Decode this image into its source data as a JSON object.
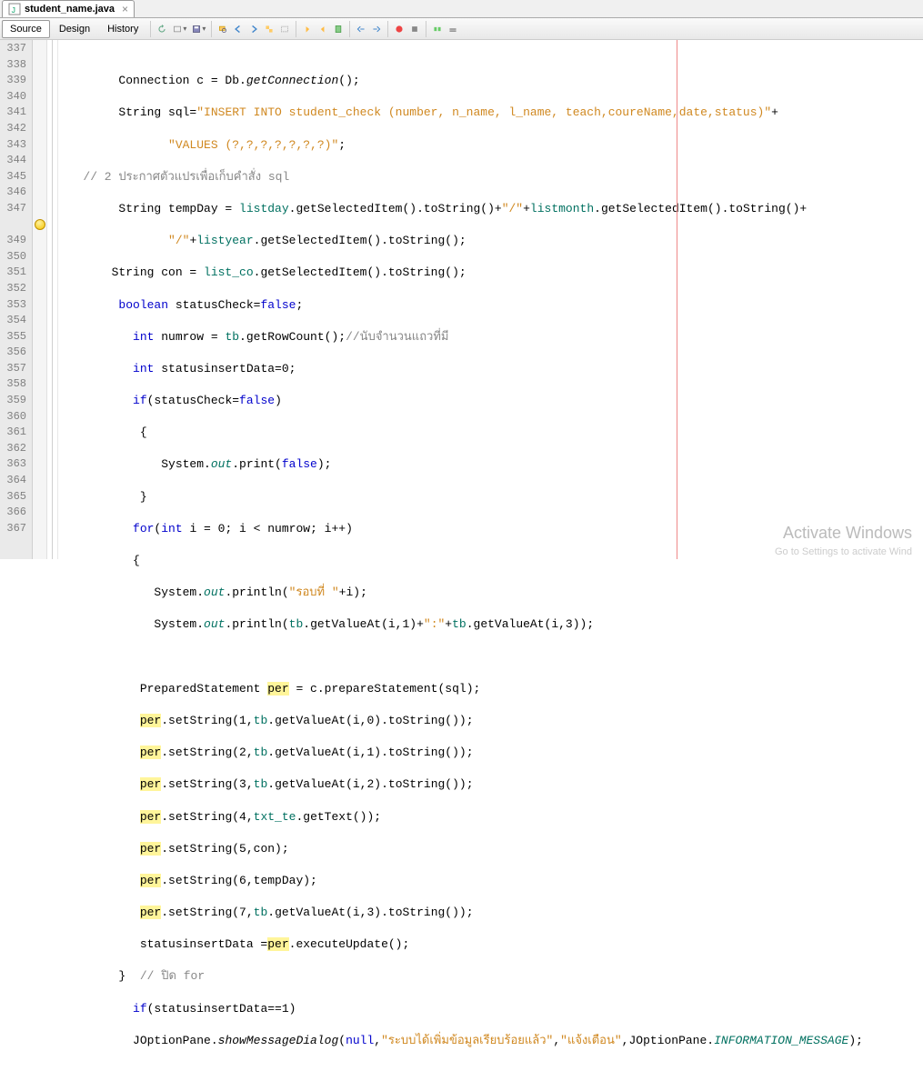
{
  "tab": {
    "title": "student_name.java"
  },
  "views": {
    "source": "Source",
    "design": "Design",
    "history": "History"
  },
  "lines": [
    "337",
    "338",
    "339",
    "340",
    "341",
    "342",
    "343",
    "344",
    "345",
    "346",
    "347",
    "",
    "349",
    "350",
    "351",
    "352",
    "353",
    "354",
    "355",
    "356",
    "357",
    "358",
    "359",
    "360",
    "361",
    "362",
    "363",
    "364",
    "365",
    "366",
    "367"
  ],
  "bulb_at": 11,
  "code": {
    "l337": [
      "        Connection c = Db.",
      "getConnection",
      "();"
    ],
    "l338": [
      "        String sql=",
      "\"INSERT INTO student_check (number, n_name, l_name, teach,coureName,date,status)\"",
      "+"
    ],
    "l339": [
      "               ",
      "\"VALUES (?,?,?,?,?,?,?)\"",
      ";"
    ],
    "l340": [
      "   // 2 ประกาศตัวแปรเพื่อเก็บคำสั่ง sql"
    ],
    "l341a": "        String tempDay = ",
    "l341b": "listday",
    "l341c": ".getSelectedItem().toString()+",
    "l341d": "\"/\"",
    "l341e": "+",
    "l341f": "listmonth",
    "l341g": ".getSelectedItem().toString()+",
    "l342a": "               ",
    "l342b": "\"/\"",
    "l342c": "+",
    "l342d": "listyear",
    "l342e": ".getSelectedItem().toString();",
    "l343a": "       String con = ",
    "l343b": "list_co",
    "l343c": ".getSelectedItem().toString();",
    "l344a": "        ",
    "l344b": "boolean",
    "l344c": " statusCheck=",
    "l344d": "false",
    "l344e": ";",
    "l345a": "          ",
    "l345b": "int",
    "l345c": " numrow = ",
    "l345d": "tb",
    "l345e": ".getRowCount();",
    "l345f": "//นับจำนวนแถวที่มี",
    "l346a": "          ",
    "l346b": "int",
    "l346c": " statusinsertData=0;",
    "l347a": "          ",
    "l347b": "if",
    "l347c": "(statusCheck=",
    "l347d": "false",
    "l347e": ")",
    "l348": "           {",
    "l349a": "              System.",
    "l349b": "out",
    "l349c": ".print(",
    "l349d": "false",
    "l349e": ");",
    "l350": "           }",
    "l351a": "          ",
    "l351b": "for",
    "l351c": "(",
    "l351d": "int",
    "l351e": " i = 0; i < numrow; i++)",
    "l352": "          {",
    "l353a": "             System.",
    "l353b": "out",
    "l353c": ".println(",
    "l353d": "\"รอบที่ \"",
    "l353e": "+i);",
    "l354a": "             System.",
    "l354b": "out",
    "l354c": ".println(",
    "l354d": "tb",
    "l354e": ".getValueAt(i,1)+",
    "l354f": "\":\"",
    "l354g": "+",
    "l354h": "tb",
    "l354i": ".getValueAt(i,3));",
    "l355": "",
    "l356a": "           PreparedStatement ",
    "l356b": "per",
    "l356c": " = c.prepareStatement(sql);",
    "l357a": "           ",
    "l357b": "per",
    "l357c": ".setString(1,",
    "l357d": "tb",
    "l357e": ".getValueAt(i,0).toString());",
    "l358a": "           ",
    "l358b": "per",
    "l358c": ".setString(2,",
    "l358d": "tb",
    "l358e": ".getValueAt(i,1).toString());",
    "l359a": "           ",
    "l359b": "per",
    "l359c": ".setString(3,",
    "l359d": "tb",
    "l359e": ".getValueAt(i,2).toString());",
    "l360a": "           ",
    "l360b": "per",
    "l360c": ".setString(4,",
    "l360d": "txt_te",
    "l360e": ".getText());",
    "l361a": "           ",
    "l361b": "per",
    "l361c": ".setString(5,con);",
    "l362a": "           ",
    "l362b": "per",
    "l362c": ".setString(6,tempDay);",
    "l363a": "           ",
    "l363b": "per",
    "l363c": ".setString(7,",
    "l363d": "tb",
    "l363e": ".getValueAt(i,3).toString());",
    "l364a": "           statusinsertData =",
    "l364b": "per",
    "l364c": ".executeUpdate();",
    "l365a": "        }  ",
    "l365b": "// ปิด for",
    "l366a": "          ",
    "l366b": "if",
    "l366c": "(statusinsertData==1)",
    "l367a": "          JOptionPane.",
    "l367b": "showMessageDialog",
    "l367c": "(",
    "l367d": "null",
    "l367e": ",",
    "l367f": "\"ระบบได้เพิ่มข้อมูลเรียบร้อยแล้ว\"",
    "l367g": ",",
    "l367h": "\"แจ้งเตือน\"",
    "l367i": ",JOptionPane.",
    "l367j": "INFORMATION_MESSAGE",
    "l367k": ");"
  },
  "watermark": {
    "title": "Activate Windows",
    "sub": "Go to Settings to activate Wind"
  }
}
